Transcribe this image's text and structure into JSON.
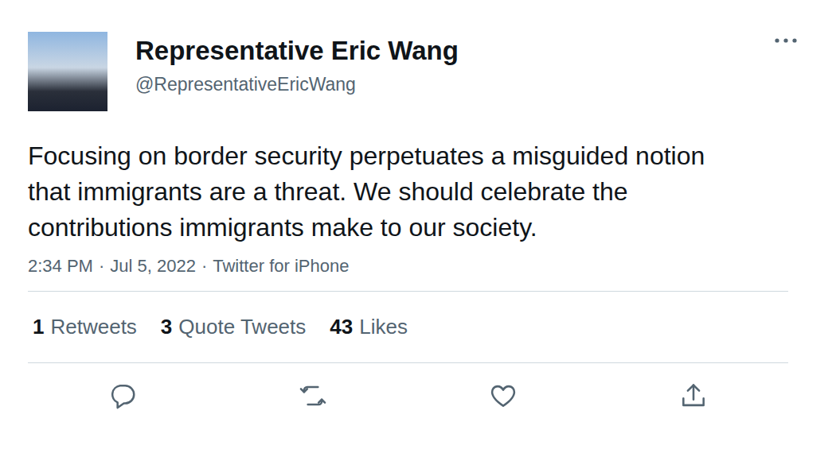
{
  "author": {
    "name": "Representative Eric Wang",
    "handle": "@RepresentativeEricWang"
  },
  "tweet": {
    "text": "Focusing on border security perpetuates a misguided notion that immigrants are a threat. We should celebrate the contributions immigrants make to our society."
  },
  "meta": {
    "time": "2:34 PM",
    "date": "Jul 5, 2022",
    "source": "Twitter for iPhone",
    "separator": "·"
  },
  "stats": [
    {
      "count": "1",
      "label": "Retweets"
    },
    {
      "count": "3",
      "label": "Quote Tweets"
    },
    {
      "count": "43",
      "label": "Likes"
    }
  ]
}
